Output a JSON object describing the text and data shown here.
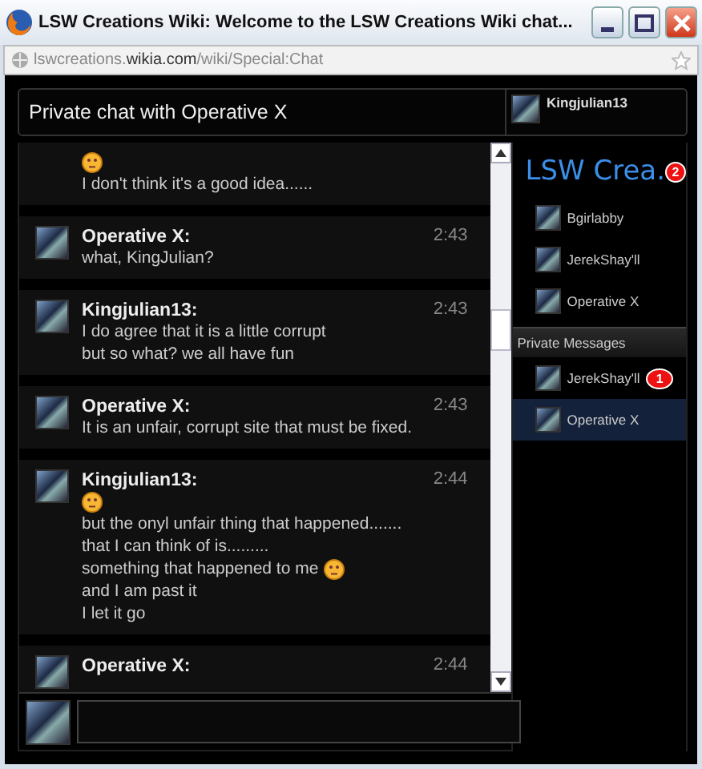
{
  "window": {
    "title": "LSW Creations Wiki: Welcome to the LSW Creations Wiki chat..."
  },
  "address_bar": {
    "url": "lswcreations.**wikia.com**/wiki/Special:Chat"
  },
  "chat": {
    "title": "Private chat with Operative X",
    "current_user": {
      "name": "Kingjulian13"
    },
    "messages": [
      {
        "lines": [
          {
            "kind": "emoji"
          },
          {
            "kind": "text",
            "text": "I don't think it's a good idea......"
          }
        ]
      },
      {
        "user": "Operative X:",
        "time": "2:43",
        "lines": [
          {
            "kind": "text",
            "text": "what, KingJulian?"
          }
        ]
      },
      {
        "user": "Kingjulian13:",
        "time": "2:43",
        "lines": [
          {
            "kind": "text",
            "text": "I do agree that it is a little corrupt"
          },
          {
            "kind": "text",
            "text": "but so what? we all have fun"
          }
        ]
      },
      {
        "user": "Operative X:",
        "time": "2:43",
        "lines": [
          {
            "kind": "text",
            "text": "It is an unfair, corrupt site that must be fixed."
          }
        ]
      },
      {
        "user": "Kingjulian13:",
        "time": "2:44",
        "lines": [
          {
            "kind": "emoji"
          },
          {
            "kind": "text",
            "text": "but the onyl unfair thing that happened......."
          },
          {
            "kind": "text",
            "text": "that I can think of is........."
          },
          {
            "kind": "text_emoji",
            "text": "something that happened to me"
          },
          {
            "kind": "text",
            "text": "and I am past it"
          },
          {
            "kind": "text",
            "text": "I let it go"
          }
        ]
      },
      {
        "user": "Operative X:",
        "time": "2:44"
      }
    ]
  },
  "sidebar": {
    "wiki_name": "LSW Crea.",
    "badge": "2",
    "users": [
      {
        "name": "Bgirlabby"
      },
      {
        "name": "JerekShay'll"
      },
      {
        "name": "Operative X"
      }
    ],
    "private_header": "Private Messages",
    "private": [
      {
        "name": "JerekShay'll",
        "badge": "1",
        "selected": false
      },
      {
        "name": "Operative X",
        "selected": true
      }
    ]
  }
}
